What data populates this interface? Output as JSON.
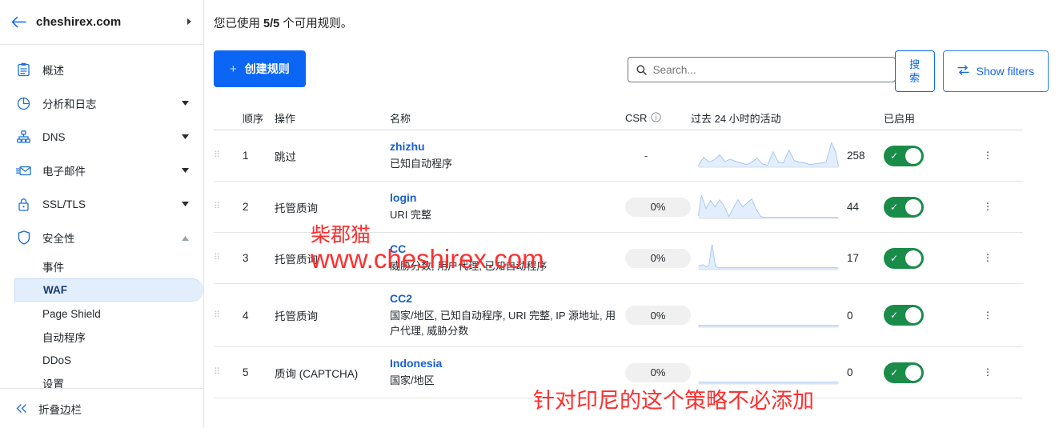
{
  "sidebar": {
    "site": {
      "name": "cheshirex.com",
      "back_icon": "back-arrow-icon",
      "expand_icon": "chevron-right-icon"
    },
    "items": [
      {
        "label": "概述",
        "icon": "clipboard-icon",
        "expandable": false
      },
      {
        "label": "分析和日志",
        "icon": "pie-chart-icon",
        "expandable": true
      },
      {
        "label": "DNS",
        "icon": "sitemap-icon",
        "expandable": true
      },
      {
        "label": "电子邮件",
        "icon": "envelope-icon",
        "expandable": true
      },
      {
        "label": "SSL/TLS",
        "icon": "lock-icon",
        "expandable": true
      },
      {
        "label": "安全性",
        "icon": "shield-icon",
        "expandable": true,
        "expanded": true
      }
    ],
    "sub_items": [
      {
        "label": "事件",
        "active": false
      },
      {
        "label": "WAF",
        "active": true
      },
      {
        "label": "Page Shield",
        "active": false
      },
      {
        "label": "自动程序",
        "active": false
      },
      {
        "label": "DDoS",
        "active": false
      },
      {
        "label": "设置",
        "active": false
      }
    ],
    "collapse": {
      "label": "折叠边栏",
      "icon": "double-chevron-left-icon"
    }
  },
  "main": {
    "quota_prefix": "您已使用 ",
    "quota_value": "5/5",
    "quota_suffix": " 个可用规则。",
    "create_button": {
      "label": "创建规则",
      "plus": "+"
    },
    "search": {
      "placeholder": "Search...",
      "value": "",
      "icon": "search-icon"
    },
    "search_button": {
      "label": "搜索"
    },
    "filters_button": {
      "label": "Show filters",
      "icon": "filters-swap-icon"
    }
  },
  "table": {
    "columns": {
      "order": "顺序",
      "action": "操作",
      "name": "名称",
      "csr": "CSR",
      "csr_info_icon": "info-icon",
      "activity": "过去 24 小时的活动",
      "enabled": "已启用"
    },
    "rows": [
      {
        "order": "1",
        "action": "跳过",
        "name": "zhizhu",
        "desc": "已知自动程序",
        "csr": "-",
        "csr_is_pill": false,
        "count": "258",
        "enabled": true,
        "spark": "10,34 17,24 24,30 31,27 38,21 45,29 52,26 59,29 66,31 73,33 80,30 87,25 94,32 101,34 108,17 115,30 122,31 129,15 136,28 143,30 150,31 157,33 164,32 171,31 178,30 185,6 190,16 194,35"
      },
      {
        "order": "2",
        "action": "托管质询",
        "name": "login",
        "desc": "URI 完整",
        "csr": "0%",
        "csr_is_pill": true,
        "count": "44",
        "enabled": true,
        "spark": "10,33 14,8 20,24 26,14 32,22 38,13 44,21 50,34 56,23 62,13 68,22 74,17 80,12 86,25 92,34 98,35 104,35 112,35 124,35 140,35 160,35 180,35 194,35"
      },
      {
        "order": "3",
        "action": "托管质询",
        "name": "CC",
        "desc": "威胁分数, 用户代理, 已知自动程序",
        "csr": "0%",
        "csr_is_pill": true,
        "count": "17",
        "enabled": true,
        "spark": "10,32 16,30 20,33 24,31 28,5 32,31 36,34 44,34 56,34 72,34 90,34 110,34 130,34 150,34 170,34 194,34"
      },
      {
        "order": "4",
        "action": "托管质询",
        "name": "CC2",
        "desc": "国家/地区, 已知自动程序, URI 完整, IP 源地址, 用户代理, 威胁分数",
        "csr": "0%",
        "csr_is_pill": true,
        "count": "0",
        "enabled": true,
        "spark": "10,34 194,34"
      },
      {
        "order": "5",
        "action": "质询 (CAPTCHA)",
        "name": "Indonesia",
        "desc": "国家/地区",
        "csr": "0%",
        "csr_is_pill": true,
        "count": "0",
        "enabled": true,
        "spark": "10,34 194,34"
      }
    ],
    "drag_handle_icon": "drag-handle-icon",
    "menu_icon": "kebab-menu-icon"
  },
  "watermarks": {
    "cat": "柴郡猫",
    "url": "www.cheshirex.com",
    "note": "针对印尼的这个策略不必添加"
  },
  "colors": {
    "accent_blue": "#0b65f5",
    "link_blue": "#1a5fd0",
    "toggle_green": "#1a8c4a",
    "watermark_red": "#fe2f2f",
    "active_pill": "#e3eefc"
  }
}
